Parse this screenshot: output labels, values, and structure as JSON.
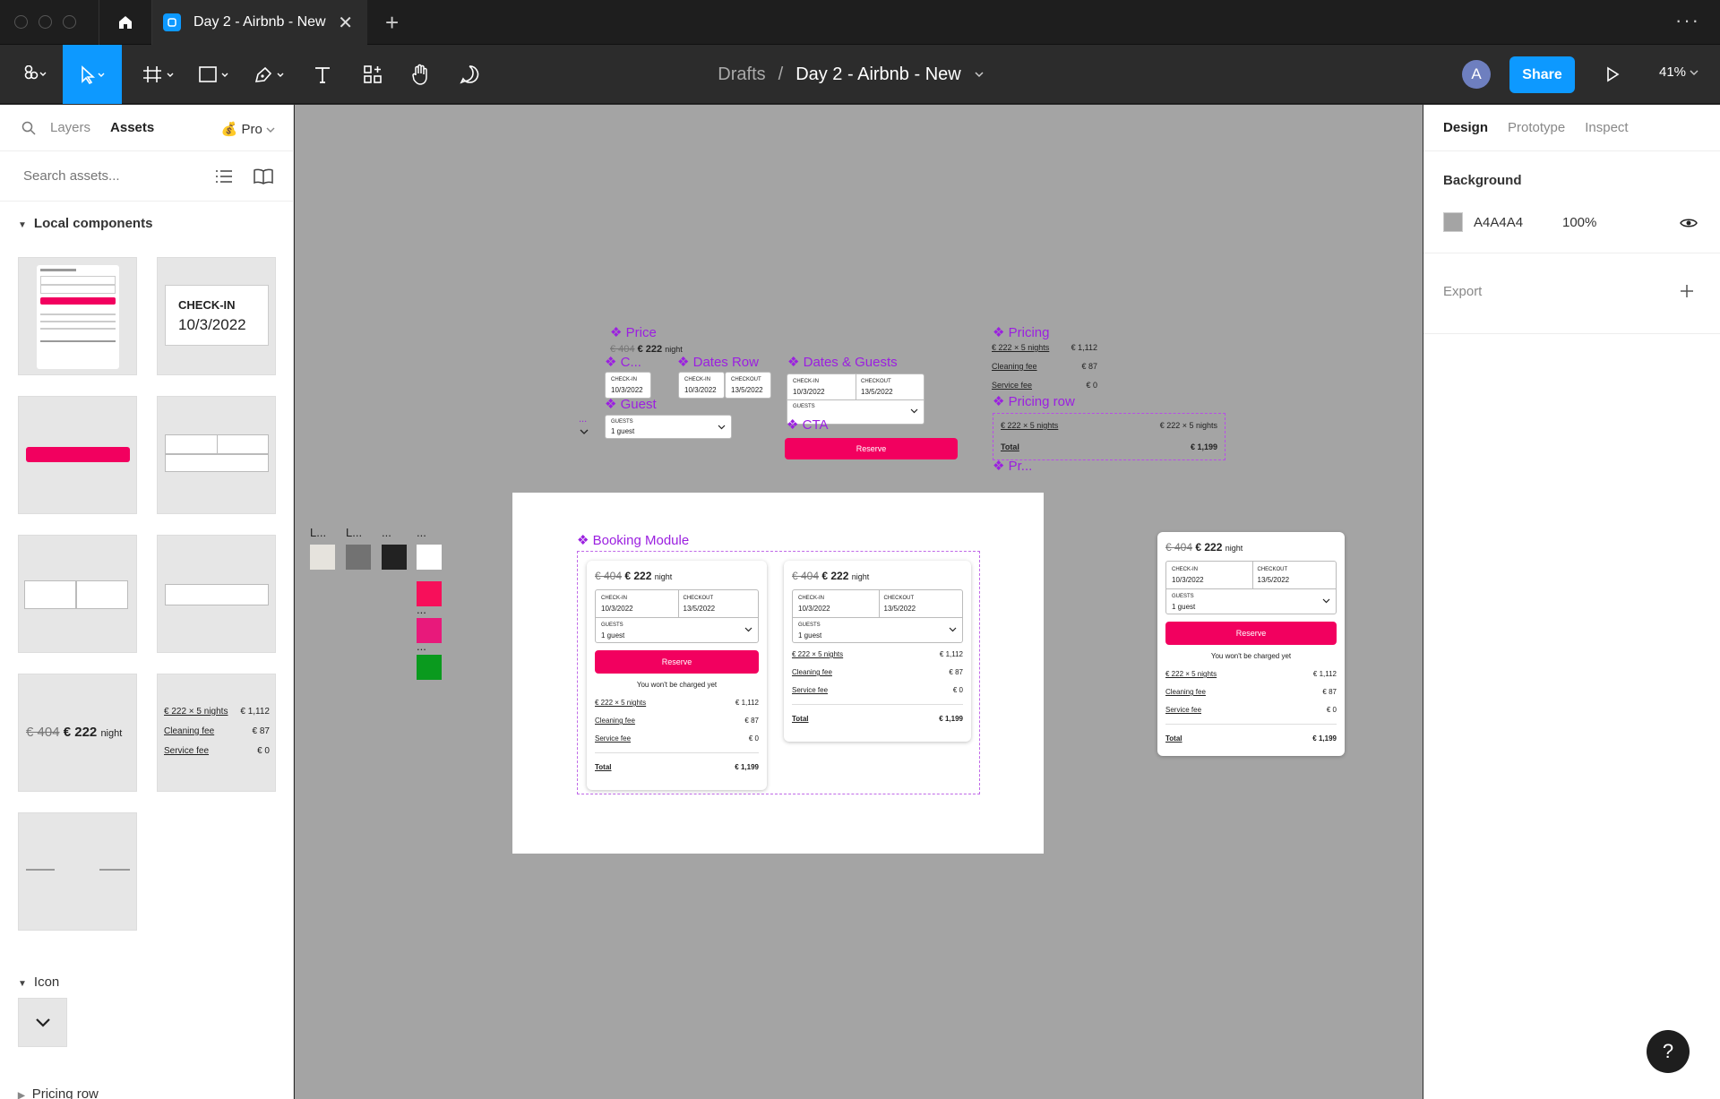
{
  "tabbar": {
    "file_tab": "Day 2 - Airbnb - New",
    "close": "✕",
    "plus": "+",
    "more": "···"
  },
  "toolbar": {
    "breadcrumb_parent": "Drafts",
    "breadcrumb_sep": "/",
    "file_name": "Day 2 - Airbnb - New",
    "avatar": "A",
    "share": "Share",
    "zoom": "41%"
  },
  "left_panel": {
    "tab_layers": "Layers",
    "tab_assets": "Assets",
    "plan": "💰 Pro",
    "search_placeholder": "Search assets...",
    "section_local": "Local components",
    "section_icon": "Icon",
    "section_pricing_row": "Pricing row"
  },
  "right_panel": {
    "tab_design": "Design",
    "tab_prototype": "Prototype",
    "tab_inspect": "Inspect",
    "background_label": "Background",
    "bg_hex": "A4A4A4",
    "bg_opacity": "100%",
    "export_label": "Export",
    "bg_color": "#A4A4A4"
  },
  "booking": {
    "old_price": "€ 404",
    "price": "€ 222",
    "night": "night",
    "checkin_label": "CHECK-IN",
    "checkin": "10/3/2022",
    "checkout_label": "CHECKOUT",
    "checkout": "13/5/2022",
    "guests_label": "GUESTS",
    "guests": "1 guest",
    "reserve": "Reserve",
    "no_charge": "You won't be charged yet",
    "nights": "€ 222 × 5 nights",
    "nights_val": "€ 1,112",
    "cleaning": "Cleaning fee",
    "cleaning_val": "€ 87",
    "service": "Service fee",
    "service_val": "€ 0",
    "total": "Total",
    "total_val": "€ 1,199"
  },
  "canvas_labels": {
    "price": "❖ Price",
    "c": "❖ C...",
    "dates_row": "❖ Dates Row",
    "dates_guests": "❖ Dates & Guests",
    "guest": "❖ Guest",
    "cta": "❖ CTA",
    "pricing": "❖ Pricing",
    "pricing_row": "❖ Pricing row",
    "pr": "❖ Pr...",
    "booking_module": "❖ Booking Module",
    "l1": "L...",
    "l2": "L...",
    "d1": "...",
    "d2": "...",
    "d3": "...",
    "d4": "...",
    "d5": "...",
    "d6": "..."
  },
  "thumb": {
    "checkin_big": "CHECK-IN",
    "checkin_big_val": "10/3/2022"
  },
  "colors": {
    "accent": "#0d99ff",
    "brand": "#f2005f",
    "component": "#9b20e0",
    "green": "#0a9a1e"
  }
}
